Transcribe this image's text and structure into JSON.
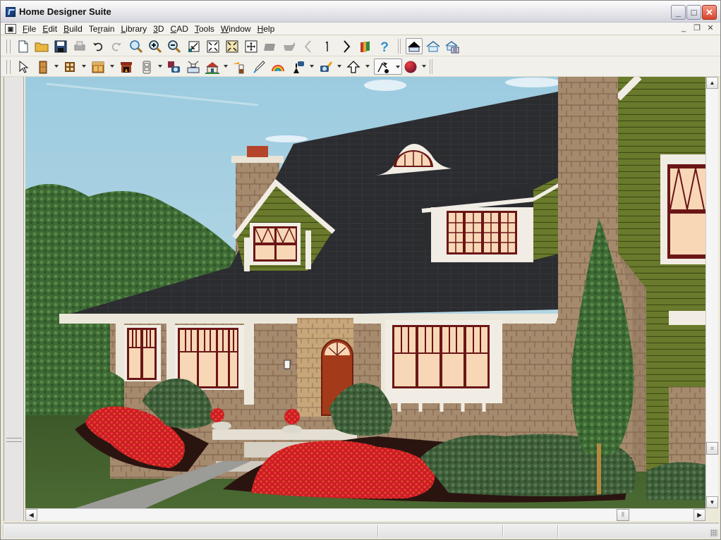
{
  "window": {
    "title": "Home Designer Suite",
    "controls": {
      "minimize": "_",
      "maximize": "□",
      "close": "✕"
    }
  },
  "menubar": {
    "doc_icon": "▣",
    "items": [
      {
        "label": "File",
        "accel": "F"
      },
      {
        "label": "Edit",
        "accel": "E"
      },
      {
        "label": "Build",
        "accel": "B"
      },
      {
        "label": "Terrain",
        "accel": "r"
      },
      {
        "label": "Library",
        "accel": "L"
      },
      {
        "label": "3D",
        "accel": "3"
      },
      {
        "label": "CAD",
        "accel": "C"
      },
      {
        "label": "Tools",
        "accel": "T"
      },
      {
        "label": "Window",
        "accel": "W"
      },
      {
        "label": "Help",
        "accel": "H"
      }
    ],
    "mdi_controls": {
      "minimize": "_",
      "restore": "❐",
      "close": "✕"
    }
  },
  "toolbar1": {
    "buttons": [
      {
        "icon": "new-file-icon",
        "tooltip": "New"
      },
      {
        "icon": "open-folder-icon",
        "tooltip": "Open"
      },
      {
        "icon": "save-icon",
        "tooltip": "Save"
      },
      {
        "icon": "print-icon",
        "tooltip": "Print",
        "disabled": true
      },
      {
        "icon": "undo-icon",
        "tooltip": "Undo"
      },
      {
        "icon": "redo-icon",
        "tooltip": "Redo",
        "disabled": true
      },
      {
        "icon": "zoom-icon",
        "tooltip": "Zoom"
      },
      {
        "icon": "zoom-in-icon",
        "tooltip": "Zoom In"
      },
      {
        "icon": "zoom-out-icon",
        "tooltip": "Zoom Out"
      },
      {
        "icon": "undo-zoom-icon",
        "tooltip": "Undo Zoom"
      },
      {
        "icon": "fill-window-icon",
        "tooltip": "Fill Window"
      },
      {
        "icon": "fill-window-all-icon",
        "tooltip": "Fill Window Building Only"
      },
      {
        "icon": "pan-icon",
        "tooltip": "Pan"
      },
      {
        "icon": "layer-down-icon",
        "tooltip": "Down One Floor",
        "disabled": true
      },
      {
        "icon": "layer-up-icon",
        "tooltip": "Up One Floor",
        "disabled": true
      },
      {
        "icon": "chevron-left-icon",
        "tooltip": "Previous",
        "disabled": true
      },
      {
        "icon": "floor-number-icon",
        "label": "1"
      },
      {
        "icon": "chevron-right-icon",
        "tooltip": "Next"
      },
      {
        "icon": "library-icon",
        "tooltip": "Library Browser"
      },
      {
        "icon": "help-icon",
        "tooltip": "Help",
        "label": "?"
      }
    ],
    "view_buttons": [
      {
        "icon": "roof-view-icon",
        "tooltip": "Exterior",
        "active": true
      },
      {
        "icon": "house-outline-icon",
        "tooltip": "Doll House"
      },
      {
        "icon": "house-plan-icon",
        "tooltip": "Plan"
      }
    ]
  },
  "toolbar2": {
    "buttons": [
      {
        "icon": "select-arrow-icon",
        "tooltip": "Select Objects"
      },
      {
        "icon": "door-icon",
        "tooltip": "Doors",
        "dropdown": true
      },
      {
        "icon": "window-icon",
        "tooltip": "Windows",
        "dropdown": true
      },
      {
        "icon": "cabinet-icon",
        "tooltip": "Cabinets",
        "dropdown": true
      },
      {
        "icon": "fireplace-icon",
        "tooltip": "Fireplace"
      },
      {
        "icon": "outlet-icon",
        "tooltip": "Electrical",
        "dropdown": true
      },
      {
        "icon": "camera-save-icon",
        "tooltip": "Camera"
      },
      {
        "icon": "projector-icon",
        "tooltip": "Elevation"
      },
      {
        "icon": "house-camera-icon",
        "tooltip": "3D View",
        "dropdown": true
      },
      {
        "icon": "paint-bucket-icon",
        "tooltip": "Material Painter"
      },
      {
        "icon": "eyedropper-icon",
        "tooltip": "Eyedropper"
      },
      {
        "icon": "rainbow-icon",
        "tooltip": "Rendering"
      },
      {
        "icon": "camera-up-icon",
        "tooltip": "Camera Position",
        "dropdown": true
      },
      {
        "icon": "camera-tool-icon",
        "tooltip": "Walkthrough",
        "dropdown": true
      },
      {
        "icon": "arrow-up-icon",
        "tooltip": "Move",
        "dropdown": true
      },
      {
        "icon": "walk-icon",
        "tooltip": "Walk Mode",
        "dropdown": true,
        "active": true
      },
      {
        "icon": "color-sphere-icon",
        "tooltip": "Materials",
        "dropdown": true
      }
    ]
  },
  "scrollbars": {
    "vertical": {
      "up": "▲",
      "down": "▼",
      "position": 0.84
    },
    "horizontal": {
      "left": "◀",
      "right": "▶",
      "position": 0.9
    }
  },
  "colors": {
    "sky": "#a9d1e0",
    "roof": "#2b2c30",
    "siding": "#6a7a2c",
    "stone": "#a68a6e",
    "trim": "#f1ede4",
    "window_frame": "#6b1616",
    "window_glass": "#f8d7b6",
    "door": "#a33a1a",
    "lawn": "#3e5a2a",
    "mulch": "#2a1410",
    "flowers": "#e8222a",
    "path": "#9b9b98"
  },
  "statusbar": {
    "segments": [
      "",
      "",
      "",
      ""
    ]
  }
}
